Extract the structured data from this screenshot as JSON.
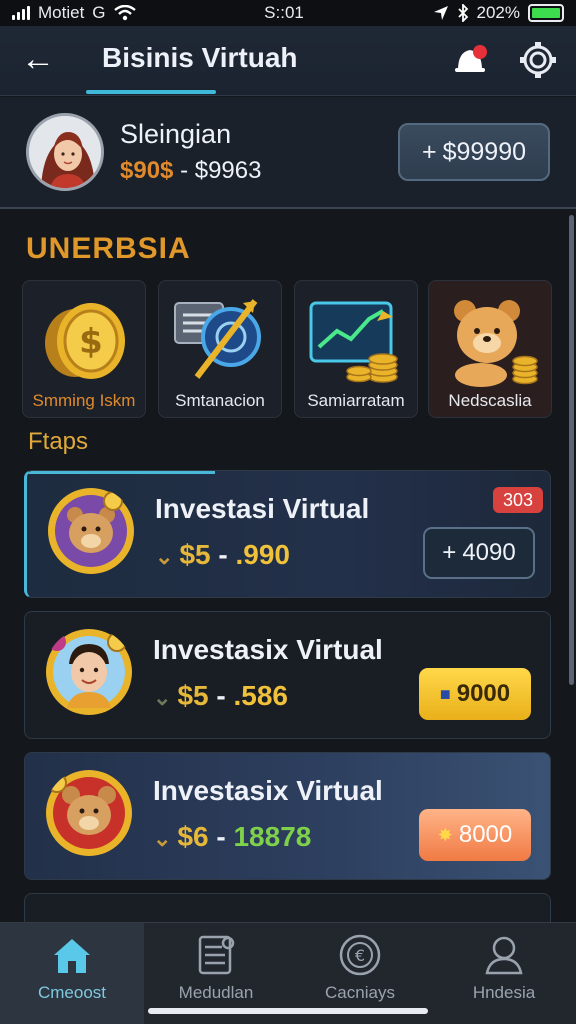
{
  "status_bar": {
    "carrier": "Motiet",
    "carrier_glyph": "G",
    "time": "S::01",
    "battery_text": "202%",
    "battery_fill": 1.0
  },
  "header": {
    "title": "Bisinis Virtuah",
    "back_icon": "arrow-left-icon",
    "notification_icon": "bell-icon",
    "settings_icon": "gear-icon"
  },
  "profile": {
    "name": "Sleingian",
    "balance_primary": "$90$",
    "balance_separator": "-",
    "balance_secondary": "$9963",
    "add_button": "$99990"
  },
  "section_title": "UNERBSIA",
  "categories": [
    {
      "label": "Smming Iskm",
      "icon": "coin-icon"
    },
    {
      "label": "Smtanacion",
      "icon": "compass-chart-icon"
    },
    {
      "label": "Samiarratam",
      "icon": "growth-chart-icon"
    },
    {
      "label": "Nedscaslia",
      "icon": "bear-coins-icon"
    }
  ],
  "subsection_title": "Ftaps",
  "investments": [
    {
      "title": "Investasi Virtual",
      "amount_prefix": "$5",
      "amount_dash": "-",
      "amount_value": ".990",
      "badge": "303",
      "button_label": "4090",
      "icon": "bear-avatar-icon"
    },
    {
      "title": "Investasix Virtual",
      "amount_prefix": "$5",
      "amount_dash": "-",
      "amount_value": ".586",
      "button_label": "9000",
      "icon": "person-avatar-icon"
    },
    {
      "title": "Investasix Virtual",
      "amount_prefix": "$6",
      "amount_dash": "-",
      "amount_value": "18878",
      "button_label": "8000",
      "icon": "bear-avatar-icon"
    }
  ],
  "bottom_nav": [
    {
      "label": "Cmeoost",
      "icon": "home-icon",
      "active": true
    },
    {
      "label": "Medudlan",
      "icon": "document-icon",
      "active": false
    },
    {
      "label": "Cacniays",
      "icon": "coin-circle-icon",
      "active": false
    },
    {
      "label": "Hndesia",
      "icon": "user-icon",
      "active": false
    }
  ],
  "colors": {
    "accent": "#40b8d8",
    "gold": "#f0c13a",
    "orange": "#e08a2c",
    "badge_red": "#d8423e"
  }
}
